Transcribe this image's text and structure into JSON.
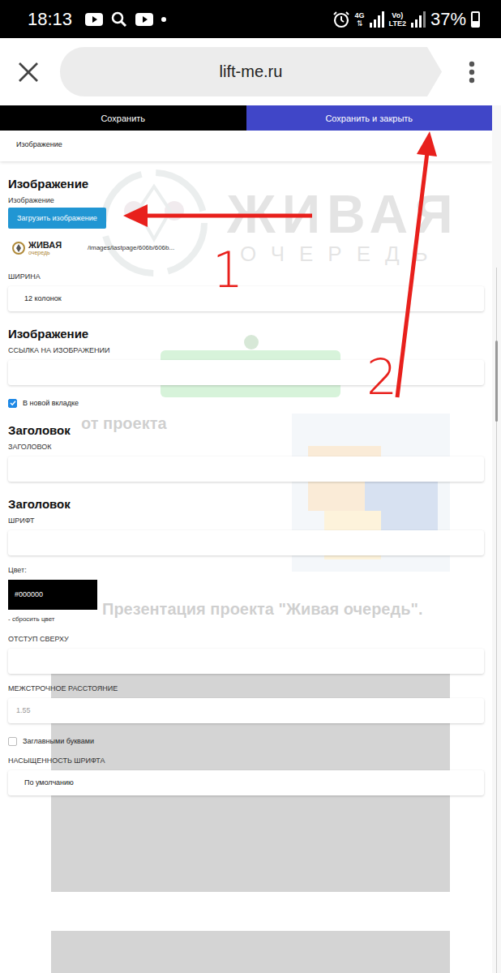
{
  "status_bar": {
    "time": "18:13",
    "network": "4G",
    "carrier_top": "Vo)",
    "carrier_bottom": "LTE2",
    "battery": "37%",
    "battery_level": 0.37
  },
  "browser": {
    "url": "lift-me.ru"
  },
  "toolbar": {
    "buttons": [
      {
        "label": "Сохранить",
        "primary": false
      },
      {
        "label": "Сохранить и закрыть",
        "primary": true
      }
    ]
  },
  "tab": {
    "label": "Изображение"
  },
  "form": {
    "items": [
      {
        "kind": "heading",
        "text": "Изображение"
      },
      {
        "kind": "label",
        "text": "Изображение"
      },
      {
        "kind": "upload",
        "text": "Загрузить изображение"
      },
      {
        "kind": "file",
        "path": "/images/lastpage/606b/606b...",
        "thumb_top": "ЖИВАЯ",
        "thumb_bottom": "очередь"
      },
      {
        "kind": "label",
        "text": "ШИРИНА"
      },
      {
        "kind": "select",
        "value": "12 колонок"
      },
      {
        "kind": "heading",
        "text": "Изображение"
      },
      {
        "kind": "label",
        "text": "ССЫЛКА НА ИЗОБРАЖЕНИИ"
      },
      {
        "kind": "input",
        "value": "",
        "placeholder": ""
      },
      {
        "kind": "checkbox",
        "text": "В новой вкладке",
        "checked": true
      },
      {
        "kind": "heading",
        "text": "Заголовок"
      },
      {
        "kind": "label",
        "text": "ЗАГОЛОВОК"
      },
      {
        "kind": "input",
        "value": "",
        "placeholder": ""
      },
      {
        "kind": "heading",
        "text": "Заголовок"
      },
      {
        "kind": "label",
        "text": "ШРИФТ"
      },
      {
        "kind": "input",
        "value": "",
        "placeholder": ""
      },
      {
        "kind": "label",
        "text": "Цвет:"
      },
      {
        "kind": "color",
        "value": "#000000",
        "color": "#000000"
      },
      {
        "kind": "link",
        "text": "- сбросить цвет"
      },
      {
        "kind": "label",
        "text": "ОТСТУП СВЕРХУ"
      },
      {
        "kind": "input",
        "value": "",
        "placeholder": ""
      },
      {
        "kind": "label",
        "text": "МЕЖСТРОЧНОЕ РАССТОЯНИЕ"
      },
      {
        "kind": "input",
        "value": "",
        "placeholder": "1.55"
      },
      {
        "kind": "checkbox",
        "text": "Заглавными буквами",
        "checked": false
      },
      {
        "kind": "label",
        "text": "НАСЫЩЕННОСТЬ ШРИФТА"
      },
      {
        "kind": "select",
        "value": "По умолчанию"
      }
    ]
  },
  "background_page": {
    "logo_top": "ЖИВАЯ",
    "logo_bottom": "ОЧЕРЕДЬ",
    "bonus_heading": "от проекта",
    "presentation_heading": "Презентация проекта \"Живая очередь\"."
  },
  "annotations": [
    {
      "label": "1"
    },
    {
      "label": "2"
    }
  ]
}
